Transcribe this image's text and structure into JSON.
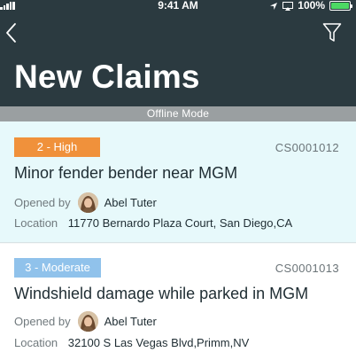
{
  "status_bar": {
    "time": "9:41 AM",
    "battery": "100%",
    "battery_level": 1.0,
    "icons": [
      "cell-signal-icon",
      "location-arrow-icon",
      "screen-mirror-icon",
      "battery-icon"
    ]
  },
  "header": {
    "title": "New Claims",
    "back_icon": "chevron-left-icon",
    "filter_icon": "filter-icon"
  },
  "banner": {
    "text": "Offline Mode"
  },
  "claims": [
    {
      "priority": "2 - High",
      "priority_color": "#f0913b",
      "case_number": "CS0001012",
      "title": "Minor fender bender near MGM",
      "opened_by_label": "Opened by",
      "opened_by": "Abel Tuter",
      "location_label": "Location",
      "location": "11770 Bernardo Plaza Court, San Diego,CA"
    },
    {
      "priority": "3 - Moderate",
      "priority_color": "#90c2eb",
      "case_number": "CS0001013",
      "title": "Windshield damage while parked in MGM",
      "opened_by_label": "Opened by",
      "opened_by": "Abel Tuter",
      "location_label": "Location",
      "location": "32100 S Las Vegas Blvd,Primm,NV"
    }
  ],
  "colors": {
    "header_bg": "#2b3a40",
    "banner_bg": "#9a9fa1",
    "selected_card_bg": "#e7f9fb"
  }
}
